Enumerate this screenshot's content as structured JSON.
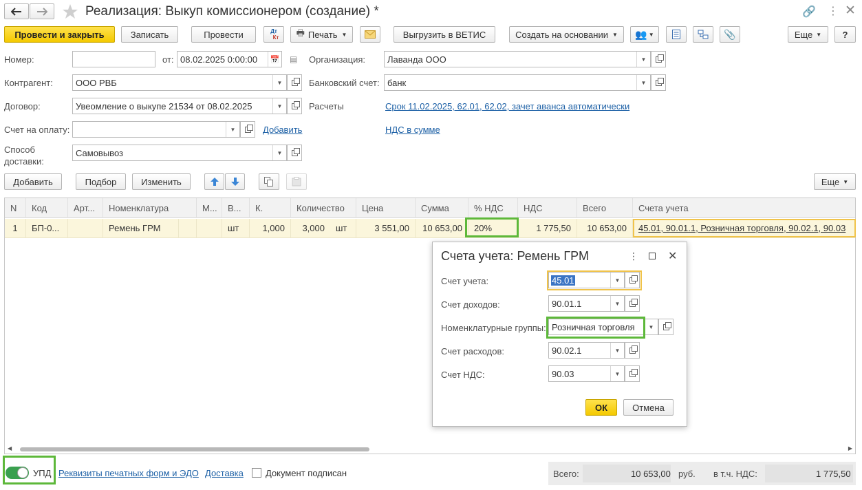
{
  "title": "Реализация: Выкуп комиссионером (создание) *",
  "toolbar": {
    "post_close": "Провести и закрыть",
    "save": "Записать",
    "post": "Провести",
    "print": "Печать",
    "upload": "Выгрузить в ВЕТИС",
    "create_based": "Создать на основании",
    "more": "Еще",
    "help": "?",
    "dtkt_top": "Дт",
    "dtkt_bottom": "Кт"
  },
  "form": {
    "number_label": "Номер:",
    "number_value": "",
    "date_label": "от:",
    "date_value": "08.02.2025  0:00:00",
    "org_label": "Организация:",
    "org_value": "Лаванда ООО",
    "contractor_label": "Контрагент:",
    "contractor_value": "ООО РВБ",
    "bank_label": "Банковский счет:",
    "bank_value": "банк",
    "contract_label": "Договор:",
    "contract_value": "Увеомление о выкупе 21534 от 08.02.2025",
    "settlements_label": "Расчеты",
    "settlements_link": "Срок 11.02.2025, 62.01, 62.02, зачет аванса автоматически",
    "invoice_label": "Счет на оплату:",
    "invoice_value": "",
    "add_link": "Добавить",
    "vat_link": "НДС в сумме",
    "delivery_label_1": "Способ",
    "delivery_label_2": "доставки:",
    "delivery_value": "Самовывоз"
  },
  "table_toolbar": {
    "add": "Добавить",
    "select": "Подбор",
    "change": "Изменить",
    "more": "Еще"
  },
  "table": {
    "headers": [
      "N",
      "Код",
      "Арт...",
      "Номенклатура",
      "М...",
      "В...",
      "К.",
      "Количество",
      "Цена",
      "Сумма",
      "% НДС",
      "НДС",
      "Всего",
      "Счета учета"
    ],
    "row": {
      "n": "1",
      "code": "БП-0...",
      "art": "",
      "nomenclature": "Ремень ГРМ",
      "m": "",
      "v": "шт",
      "k": "1,000",
      "quantity": "3,000",
      "unit": "шт",
      "price": "3 551,00",
      "sum": "10 653,00",
      "vat_rate": "20%",
      "vat": "1 775,50",
      "total": "10 653,00",
      "accounts": "45.01, 90.01.1, Розничная торговля, 90.02.1, 90.03"
    }
  },
  "dialog": {
    "title": "Счета учета: Ремень ГРМ",
    "account_label": "Счет учета:",
    "account_value": "45.01",
    "income_label": "Счет доходов:",
    "income_value": "90.01.1",
    "group_label": "Номенклатурные группы:",
    "group_value": "Розничная торговля",
    "expense_label": "Счет расходов:",
    "expense_value": "90.02.1",
    "vat_label": "Счет НДС:",
    "vat_value": "90.03",
    "ok": "ОК",
    "cancel": "Отмена"
  },
  "footer": {
    "upd_label": "УПД",
    "print_forms_link": "Реквизиты печатных форм и ЭДО",
    "delivery_link": "Доставка",
    "signed_label": "Документ подписан",
    "total_label": "Всего:",
    "total_value": "10 653,00",
    "currency": "руб.",
    "vat_incl_label": "в т.ч. НДС:",
    "vat_incl_value": "1 775,50"
  },
  "colors": {
    "accent_yellow": "#f4c900",
    "highlight_green": "#5db83a",
    "highlight_yellow": "#f0c34a",
    "row_bg": "#fbf6dc",
    "link": "#1b5fa5"
  }
}
